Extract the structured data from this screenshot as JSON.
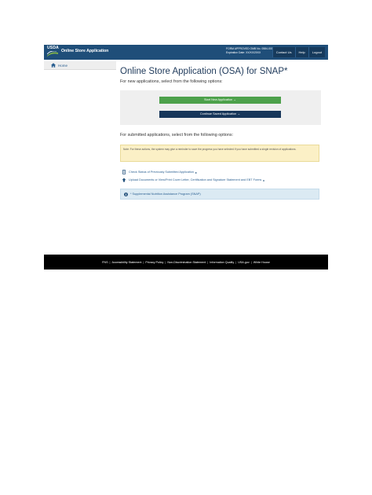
{
  "header": {
    "logo_text": "USDA",
    "app_title": "Online Store Application",
    "omb_line1": "FORM APPROVED OMB No. 0584-0008",
    "omb_line2": "Expiration Date: XX/XX/20XX",
    "nav": [
      "Contact Us",
      "Help",
      "Logout"
    ],
    "bar_color": "#1f4e79"
  },
  "sidebar": {
    "home_label": "Home",
    "home_icon": "home-icon"
  },
  "main": {
    "title": "Online Store Application (OSA) for SNAP*",
    "intro": "For new applications, select from the following options:",
    "start_button": "Start New Application →",
    "continue_button": "Continue Saved Application →",
    "submitted_intro": "For submitted applications, select from the following options:",
    "note": "Note: For these actions, the system may give a reminder to save the progress you have selected if you have submitted a single revision of applications.",
    "links": [
      {
        "icon": "document-icon",
        "label": "Check Status of Previously Submitted Application"
      },
      {
        "icon": "upload-icon",
        "label": "Upload Documents or View/Print Cover Letter, Certification and Signature Statement and EBT Forms"
      }
    ],
    "snap_note": "* Supplemental Nutrition Assistance Program (SNAP)",
    "colors": {
      "green": "#4da14b",
      "navy": "#17365a",
      "note_bg": "#fbf0c6",
      "info_bg": "#dbeaf3"
    }
  },
  "footer": {
    "links": [
      "FNS",
      "Accessibility Statement",
      "Privacy Policy",
      "Non-Discrimination Statement",
      "Information Quality",
      "USA.gov",
      "White House"
    ]
  }
}
